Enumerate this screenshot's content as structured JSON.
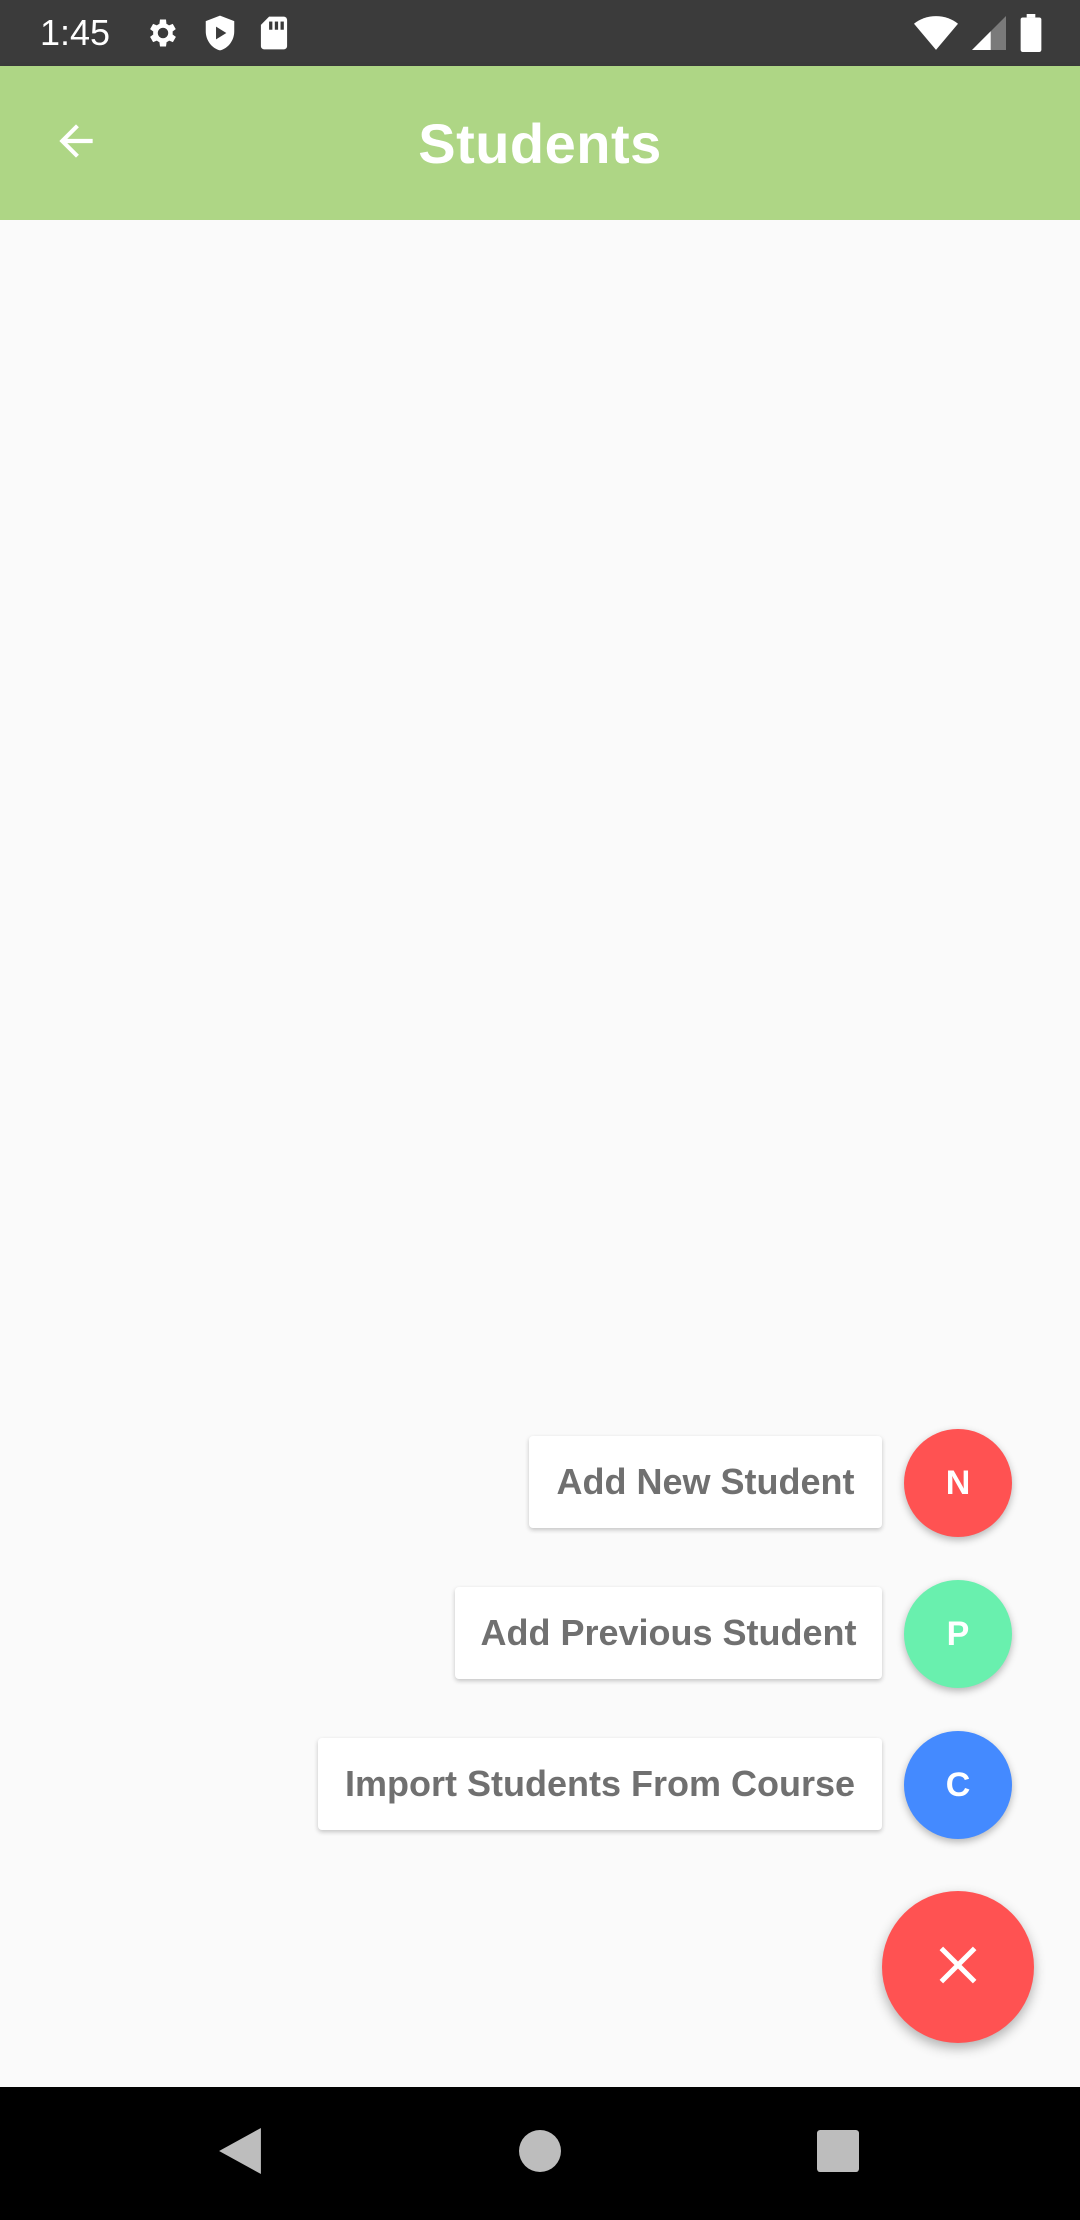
{
  "status_bar": {
    "time": "1:45",
    "left_icons": [
      "gear-icon",
      "shield-play-icon",
      "sd-card-icon"
    ],
    "right_icons": [
      "wifi-icon",
      "cell-signal-icon",
      "battery-icon"
    ]
  },
  "app_bar": {
    "title": "Students",
    "back_icon": "arrow-back-icon",
    "background_color": "#AED685"
  },
  "speed_dial": {
    "actions": [
      {
        "label": "Add New Student",
        "letter": "N",
        "color": "#FF5252"
      },
      {
        "label": "Add Previous Student",
        "letter": "P",
        "color": "#69F0AE"
      },
      {
        "label": "Import Students From Course",
        "letter": "C",
        "color": "#448AFF"
      }
    ],
    "main_fab": {
      "icon": "close-icon",
      "color": "#FF5252"
    }
  },
  "nav_bar": {
    "buttons": [
      "back-triangle-icon",
      "home-circle-icon",
      "recents-square-icon"
    ]
  }
}
